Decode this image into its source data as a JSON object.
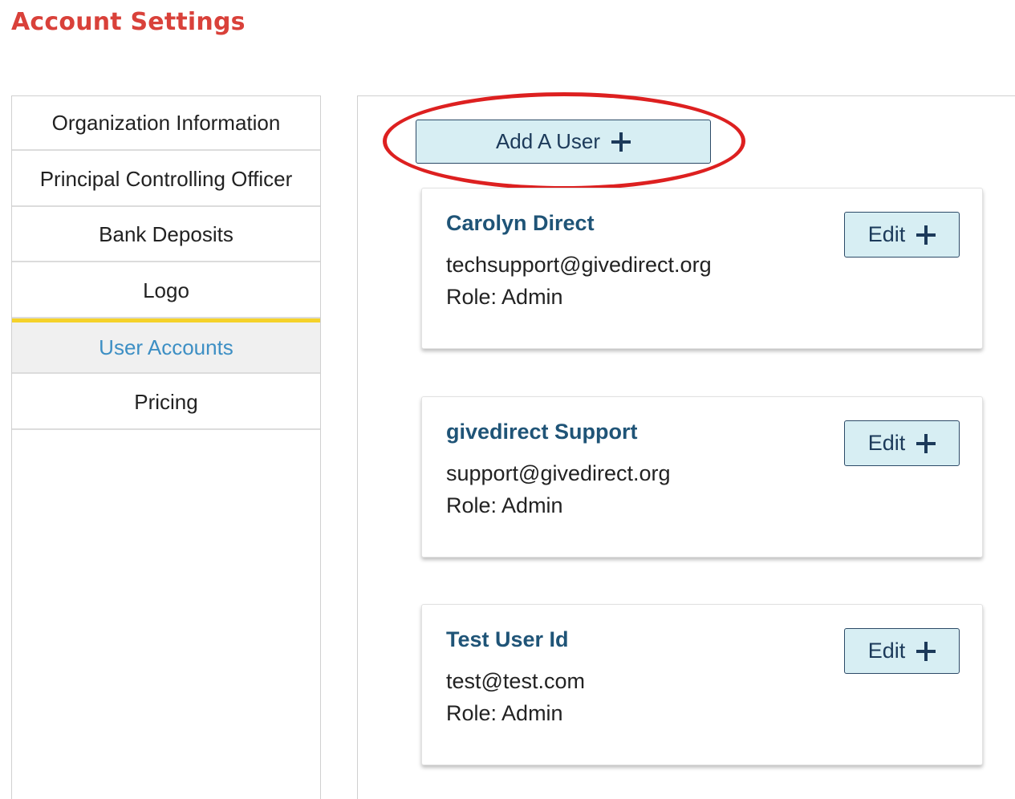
{
  "page": {
    "title": "Account Settings"
  },
  "sidebar": {
    "items": [
      {
        "label": "Organization Information"
      },
      {
        "label": "Principal Controlling Officer"
      },
      {
        "label": "Bank Deposits"
      },
      {
        "label": "Logo"
      },
      {
        "label": "User Accounts",
        "active": true
      },
      {
        "label": "Pricing"
      }
    ]
  },
  "main": {
    "add_user_label": "Add A User",
    "add_user_icon": "plus-icon",
    "users": [
      {
        "name": "Carolyn Direct",
        "email": "techsupport@givedirect.org",
        "role": "Role: Admin",
        "edit_label": "Edit"
      },
      {
        "name": "givedirect Support",
        "email": "support@givedirect.org",
        "role": "Role: Admin",
        "edit_label": "Edit"
      },
      {
        "name": "Test User Id",
        "email": "test@test.com",
        "role": "Role: Admin",
        "edit_label": "Edit"
      }
    ]
  },
  "colors": {
    "title": "#d9413a",
    "active_tab_text": "#3d8fc4",
    "active_tab_indicator": "#f5d22a",
    "button_bg": "#d7eef3",
    "user_name": "#1f5477",
    "annotation_ring": "#dd2020"
  }
}
